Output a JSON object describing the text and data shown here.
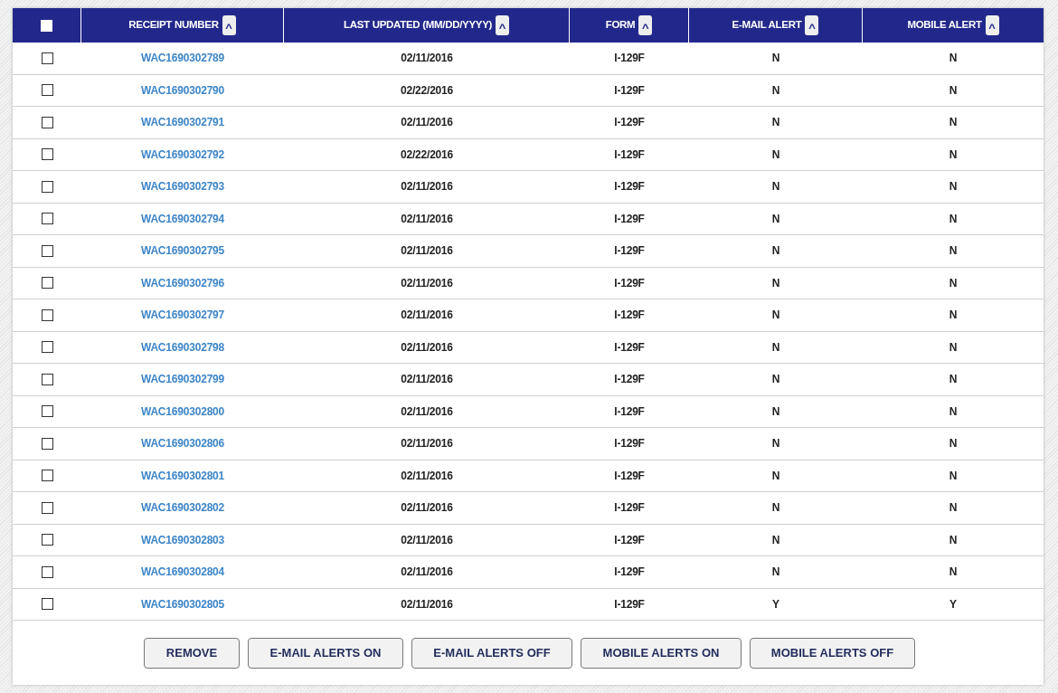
{
  "table": {
    "select_all": {
      "checked": false
    },
    "columns": [
      {
        "label": "RECEIPT NUMBER",
        "sort_icon": "^"
      },
      {
        "label": "LAST UPDATED (MM/DD/YYYY)",
        "sort_icon": "^"
      },
      {
        "label": "FORM",
        "sort_icon": "^"
      },
      {
        "label": "E-MAIL ALERT",
        "sort_icon": "^"
      },
      {
        "label": "MOBILE ALERT",
        "sort_icon": "^"
      }
    ],
    "rows": [
      {
        "checked": false,
        "receipt": "WAC1690302789",
        "updated": "02/11/2016",
        "form": "I-129F",
        "email": "N",
        "mobile": "N"
      },
      {
        "checked": false,
        "receipt": "WAC1690302790",
        "updated": "02/22/2016",
        "form": "I-129F",
        "email": "N",
        "mobile": "N"
      },
      {
        "checked": false,
        "receipt": "WAC1690302791",
        "updated": "02/11/2016",
        "form": "I-129F",
        "email": "N",
        "mobile": "N"
      },
      {
        "checked": false,
        "receipt": "WAC1690302792",
        "updated": "02/22/2016",
        "form": "I-129F",
        "email": "N",
        "mobile": "N"
      },
      {
        "checked": false,
        "receipt": "WAC1690302793",
        "updated": "02/11/2016",
        "form": "I-129F",
        "email": "N",
        "mobile": "N"
      },
      {
        "checked": false,
        "receipt": "WAC1690302794",
        "updated": "02/11/2016",
        "form": "I-129F",
        "email": "N",
        "mobile": "N"
      },
      {
        "checked": false,
        "receipt": "WAC1690302795",
        "updated": "02/11/2016",
        "form": "I-129F",
        "email": "N",
        "mobile": "N"
      },
      {
        "checked": false,
        "receipt": "WAC1690302796",
        "updated": "02/11/2016",
        "form": "I-129F",
        "email": "N",
        "mobile": "N"
      },
      {
        "checked": false,
        "receipt": "WAC1690302797",
        "updated": "02/11/2016",
        "form": "I-129F",
        "email": "N",
        "mobile": "N"
      },
      {
        "checked": false,
        "receipt": "WAC1690302798",
        "updated": "02/11/2016",
        "form": "I-129F",
        "email": "N",
        "mobile": "N"
      },
      {
        "checked": false,
        "receipt": "WAC1690302799",
        "updated": "02/11/2016",
        "form": "I-129F",
        "email": "N",
        "mobile": "N"
      },
      {
        "checked": false,
        "receipt": "WAC1690302800",
        "updated": "02/11/2016",
        "form": "I-129F",
        "email": "N",
        "mobile": "N"
      },
      {
        "checked": false,
        "receipt": "WAC1690302806",
        "updated": "02/11/2016",
        "form": "I-129F",
        "email": "N",
        "mobile": "N"
      },
      {
        "checked": false,
        "receipt": "WAC1690302801",
        "updated": "02/11/2016",
        "form": "I-129F",
        "email": "N",
        "mobile": "N"
      },
      {
        "checked": false,
        "receipt": "WAC1690302802",
        "updated": "02/11/2016",
        "form": "I-129F",
        "email": "N",
        "mobile": "N"
      },
      {
        "checked": false,
        "receipt": "WAC1690302803",
        "updated": "02/11/2016",
        "form": "I-129F",
        "email": "N",
        "mobile": "N"
      },
      {
        "checked": false,
        "receipt": "WAC1690302804",
        "updated": "02/11/2016",
        "form": "I-129F",
        "email": "N",
        "mobile": "N"
      },
      {
        "checked": false,
        "receipt": "WAC1690302805",
        "updated": "02/11/2016",
        "form": "I-129F",
        "email": "Y",
        "mobile": "Y"
      }
    ]
  },
  "buttons": [
    "REMOVE",
    "E-MAIL ALERTS ON",
    "E-MAIL ALERTS OFF",
    "MOBILE ALERTS ON",
    "MOBILE ALERTS OFF"
  ]
}
